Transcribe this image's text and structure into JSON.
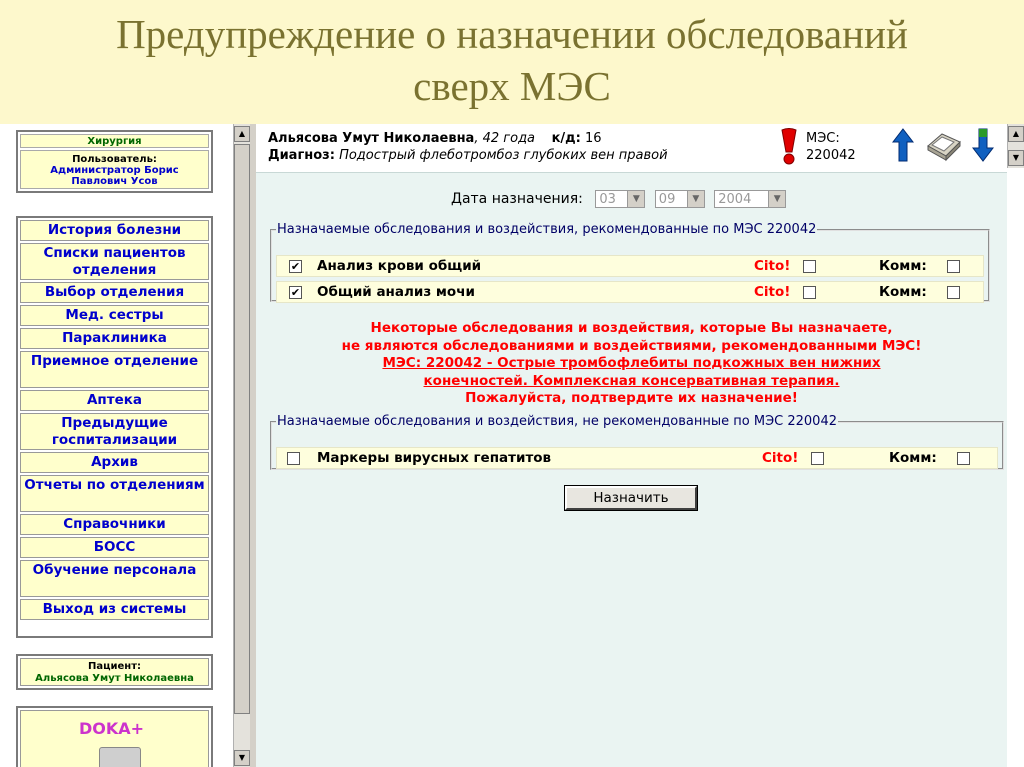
{
  "slide": {
    "title_line1": "Предупреждение о назначении обследований",
    "title_line2": "сверх МЭС"
  },
  "sidebar": {
    "department": "Хирургия",
    "user_label": "Пользователь:",
    "user_name_1": "Администратор Борис",
    "user_name_2": "Павлович Усов",
    "menu": [
      {
        "label": "История болезни"
      },
      {
        "label": "Списки пациентов отделения"
      },
      {
        "label": "Выбор отделения"
      },
      {
        "label": "Мед. сестры"
      },
      {
        "label": "Параклиника"
      },
      {
        "label": "Приемное отделение"
      },
      {
        "label": "Аптека"
      },
      {
        "label": "Предыдущие госпитализации"
      },
      {
        "label": "Архив"
      },
      {
        "label": "Отчеты по отделениям"
      },
      {
        "label": "Справочники"
      },
      {
        "label": "БОСС"
      },
      {
        "label": "Обучение персонала"
      },
      {
        "label": "Выход из системы"
      }
    ],
    "patient_label": "Пациент:",
    "patient_name": "Альясова Умут Николаевна",
    "logo": "DOKA+"
  },
  "header": {
    "patient_name": "Альясова Умут Николаевна",
    "age": ", 42 года",
    "kd_label": "к/д:",
    "kd_value": "16",
    "diag_label": "Диагноз:",
    "diag_value": "Подострый флеботромбоз глубоких вен правой",
    "mes_label": "МЭС:",
    "mes_code": "220042"
  },
  "form": {
    "date_label": "Дата назначения:",
    "day": "03",
    "month": "09",
    "year": "2004"
  },
  "recommended": {
    "legend": "Назначаемые обследования и воздействия, рекомендованные по МЭС 220042",
    "items": [
      {
        "label": "Анализ крови общий",
        "checked": "✔",
        "cito": "Cito!",
        "komm": "Комм:"
      },
      {
        "label": "Общий анализ мочи",
        "checked": "✔",
        "cito": "Cito!",
        "komm": "Комм:"
      }
    ]
  },
  "warning": {
    "line1": "Некоторые обследования и воздействия, которые Вы назначаете,",
    "line2": "не являются обследованиями и воздействиями, рекомендованными МЭС!",
    "line3": "МЭС: 220042 - Острые тромбофлебиты подкожных вен нижних",
    "line4": "конечностей. Комплексная консервативная терапия.",
    "line5": "Пожалуйста, подтвердите их назначение!"
  },
  "not_recommended": {
    "legend": "Назначаемые обследования и воздействия, не рекомендованные по МЭС 220042",
    "items": [
      {
        "label": "Маркеры вирусных гепатитов",
        "cito": "Cito!",
        "komm": "Комм:"
      }
    ]
  },
  "submit_label": "Назначить",
  "colors": {
    "slide_bg": "#fdf8cc",
    "title": "#7a7230",
    "menu_text": "#0000cc",
    "menu_bg": "#ffffcc",
    "warning": "#ff0000",
    "main_bg": "#eaf4f2"
  }
}
